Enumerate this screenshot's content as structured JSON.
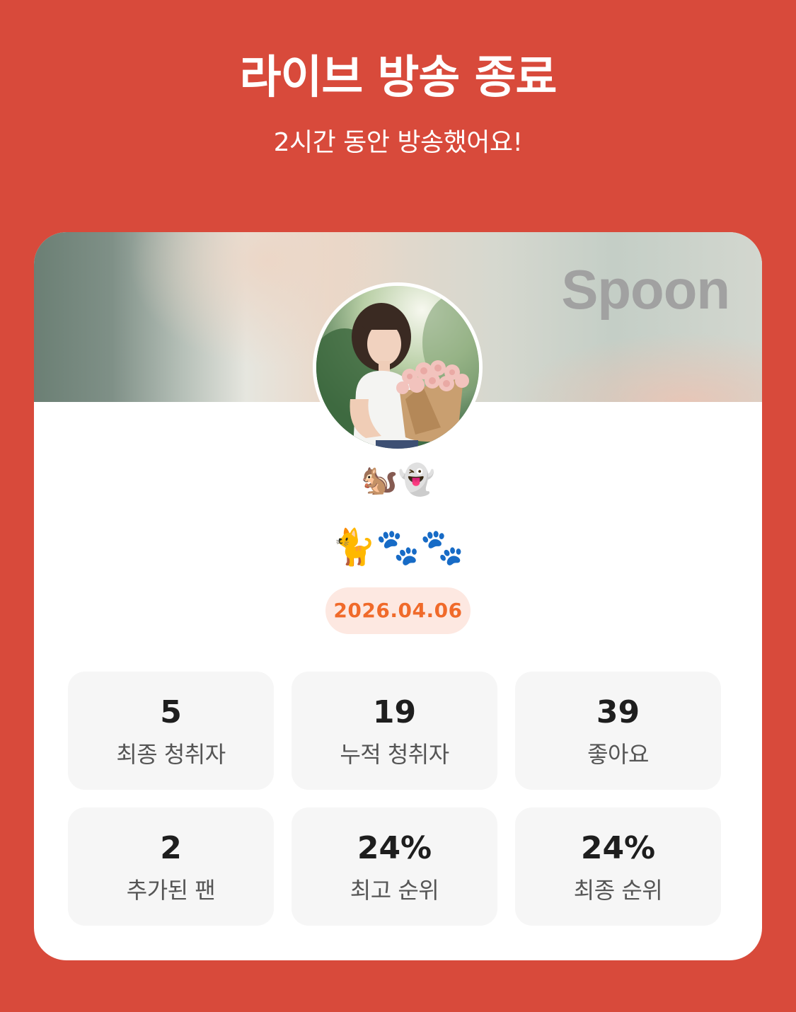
{
  "header": {
    "title": "라이브 방송 종료",
    "subtitle": "2시간 동안 방송했어요!"
  },
  "card": {
    "brand": "Spoon",
    "nickname": "🐿️👻",
    "bio": "🐈🐾🐾",
    "date": "2026.04.06"
  },
  "stats": [
    {
      "value": "5",
      "label": "최종 청취자"
    },
    {
      "value": "19",
      "label": "누적 청취자"
    },
    {
      "value": "39",
      "label": "좋아요"
    },
    {
      "value": "2",
      "label": "추가된 팬"
    },
    {
      "value": "24%",
      "label": "최고 순위"
    },
    {
      "value": "24%",
      "label": "최종 순위"
    }
  ],
  "colors": {
    "background": "#d84a3b",
    "date_text": "#f06a2a",
    "date_pill": "#fde8e1",
    "stat_tile": "#f6f6f6"
  }
}
